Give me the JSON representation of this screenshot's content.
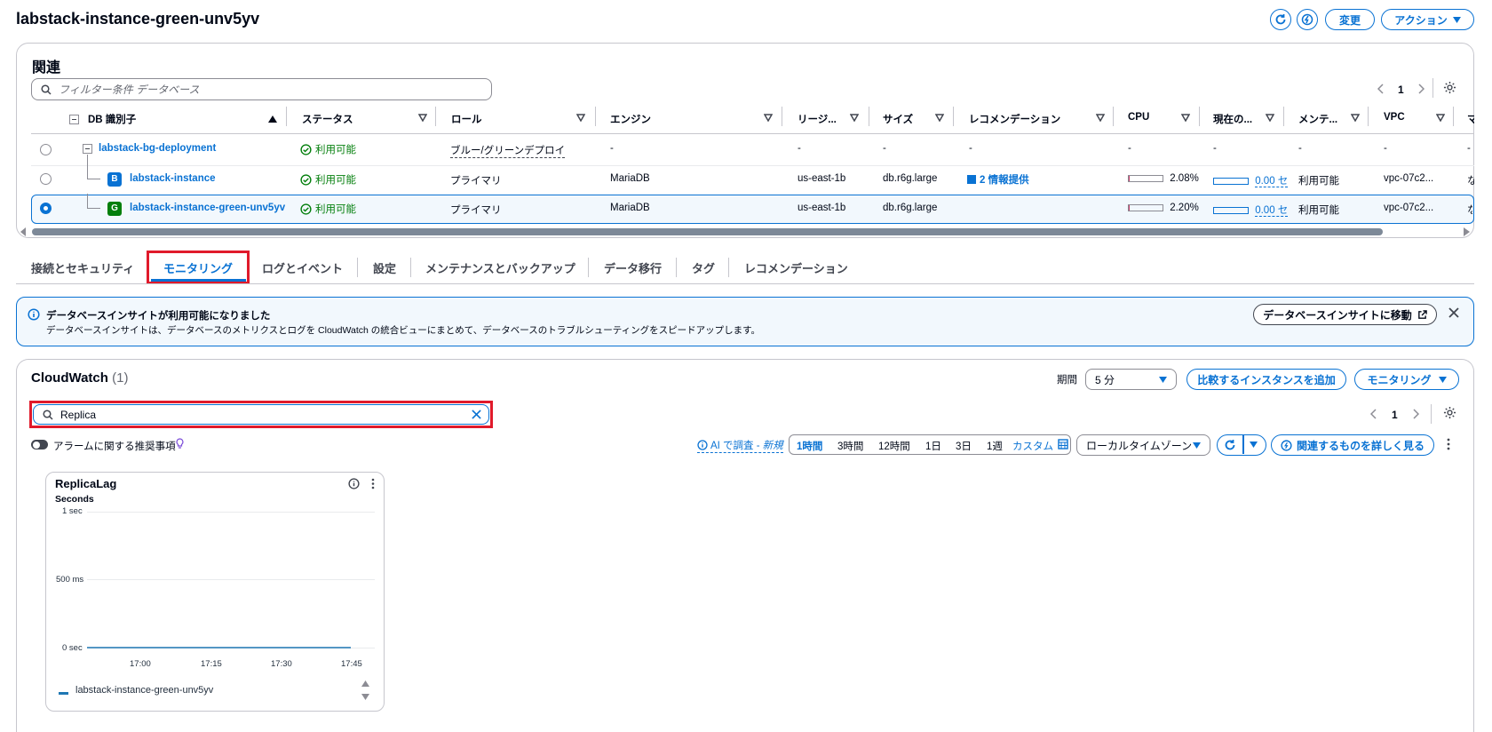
{
  "page": {
    "title": "labstack-instance-green-unv5yv",
    "header_buttons": {
      "modify": "変更",
      "actions": "アクション"
    }
  },
  "related": {
    "title": "関連",
    "filter_placeholder": "フィルター条件 データベース",
    "pagination": {
      "current": "1"
    },
    "columns": [
      "DB 識別子",
      "ステータス",
      "ロール",
      "エンジン",
      "リージ...",
      "サイズ",
      "レコメンデーション",
      "CPU",
      "現在の...",
      "メンテ...",
      "VPC",
      "マ"
    ],
    "rows": [
      {
        "id": "labstack-bg-deployment",
        "badge": "",
        "status": "利用可能",
        "role": "ブルー/グリーンデプロイ",
        "engine": "-",
        "region": "-",
        "size": "-",
        "recommendation": "-",
        "cpu": "-",
        "current": "-",
        "maintenance": "-",
        "vpc": "-",
        "extra": "-",
        "selected": false
      },
      {
        "id": "labstack-instance",
        "badge": "B",
        "status": "利用可能",
        "role": "プライマリ",
        "engine": "MariaDB",
        "region": "us-east-1b",
        "size": "db.r6g.large",
        "recommendation": "2 情報提供",
        "cpu": "2.08%",
        "cpu_value": 0.0208,
        "current": "0.00 セ",
        "maintenance": "利用可能",
        "vpc": "vpc-07c2...",
        "extra": "な",
        "selected": false
      },
      {
        "id": "labstack-instance-green-unv5yv",
        "badge": "G",
        "status": "利用可能",
        "role": "プライマリ",
        "engine": "MariaDB",
        "region": "us-east-1b",
        "size": "db.r6g.large",
        "recommendation": "",
        "cpu": "2.20%",
        "cpu_value": 0.022,
        "current": "0.00 セ",
        "maintenance": "利用可能",
        "vpc": "vpc-07c2...",
        "extra": "な",
        "selected": true
      }
    ]
  },
  "tabs": [
    "接続とセキュリティ",
    "モニタリング",
    "ログとイベント",
    "設定",
    "メンテナンスとバックアップ",
    "データ移行",
    "タグ",
    "レコメンデーション"
  ],
  "active_tab": "モニタリング",
  "banner": {
    "title": "データベースインサイトが利用可能になりました",
    "text": "データベースインサイトは、データベースのメトリクスとログを CloudWatch の統合ビューにまとめて、データベースのトラブルシューティングをスピードアップします。",
    "button": "データベースインサイトに移動"
  },
  "cloudwatch": {
    "title": "CloudWatch",
    "count": "(1)",
    "period_label": "期間",
    "period_value": "5 分",
    "add_compare_button": "比較するインスタンスを追加",
    "monitoring_button": "モニタリング",
    "search_value": "Replica",
    "pagination": {
      "current": "1"
    },
    "alarm_toggle_label": "アラームに関する推奨事項",
    "ai_link": "AI で調査 - ",
    "ai_new": "新規",
    "time_ranges": [
      "1時間",
      "3時間",
      "12時間",
      "1日",
      "3日",
      "1週"
    ],
    "time_selected": "1時間",
    "custom_label": "カスタム",
    "timezone": "ローカルタイムゾーン",
    "related_button": "関連するものを詳しく見る"
  },
  "widget": {
    "title": "ReplicaLag",
    "unit": "Seconds",
    "legend": "labstack-instance-green-unv5yv"
  },
  "chart_data": {
    "type": "line",
    "title": "ReplicaLag",
    "ylabel": "Seconds",
    "yticks": [
      "1 sec",
      "500 ms",
      "0 sec"
    ],
    "ylim": [
      0,
      1
    ],
    "xticks": [
      "17:00",
      "17:15",
      "17:30",
      "17:45"
    ],
    "series": [
      {
        "name": "labstack-instance-green-unv5yv",
        "color": "#1f77b4",
        "x": [
          "16:50",
          "16:55",
          "17:00",
          "17:05",
          "17:10",
          "17:15",
          "17:20",
          "17:25",
          "17:30",
          "17:35",
          "17:40",
          "17:45"
        ],
        "values": [
          0,
          0,
          0,
          0,
          0,
          0,
          0,
          0,
          0,
          0,
          0,
          0
        ]
      }
    ],
    "grid": true,
    "legend_position": "bottom"
  },
  "colors": {
    "accent": "#0972d3",
    "success": "#037f0c",
    "highlight": "#e01a2b",
    "banner_bg": "#f2f8fd"
  }
}
